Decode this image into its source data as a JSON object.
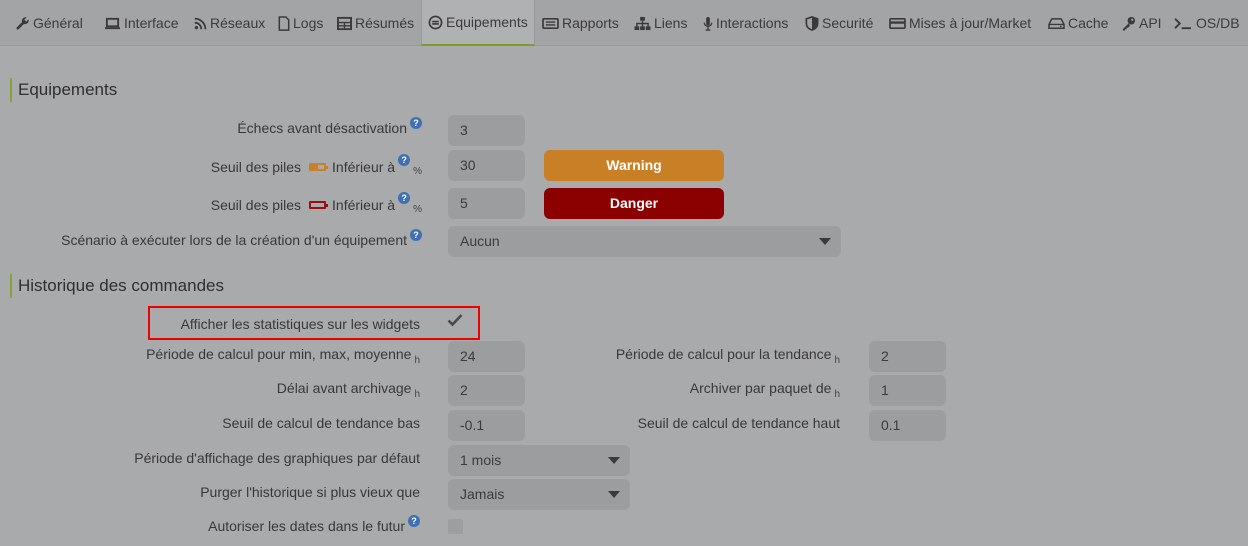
{
  "tabs": [
    {
      "label": "Général",
      "icon": "wrench-icon"
    },
    {
      "label": "Interface",
      "icon": "laptop-icon"
    },
    {
      "label": "Réseaux",
      "icon": "rss-icon"
    },
    {
      "label": "Logs",
      "icon": "file-icon"
    },
    {
      "label": "Résumés",
      "icon": "table-icon"
    },
    {
      "label": "Equipements",
      "icon": "equipment-icon"
    },
    {
      "label": "Rapports",
      "icon": "newspaper-icon"
    },
    {
      "label": "Liens",
      "icon": "sitemap-icon"
    },
    {
      "label": "Interactions",
      "icon": "microphone-icon"
    },
    {
      "label": "Securité",
      "icon": "shield-icon"
    },
    {
      "label": "Mises à jour/Market",
      "icon": "credit-card-icon"
    },
    {
      "label": "Cache",
      "icon": "hdd-icon"
    },
    {
      "label": "API",
      "icon": "key-icon"
    },
    {
      "label": "OS/DB",
      "icon": "terminal-icon"
    }
  ],
  "active_tab": "Equipements",
  "equipements": {
    "title": "Equipements",
    "echecs_label": "Échecs avant désactivation",
    "echecs_value": "3",
    "piles_label": "Seuil des piles",
    "inferieur_label": "Inférieur à",
    "percent_unit": "%",
    "warning_value": "30",
    "warning_label": "Warning",
    "danger_value": "5",
    "danger_label": "Danger",
    "scenario_label": "Scénario à exécuter lors de la création d'un équipement",
    "scenario_value": "Aucun",
    "colors": {
      "warning": "#c97f25",
      "danger": "#8b0000",
      "accent": "#86a03a"
    }
  },
  "historique": {
    "title": "Historique des commandes",
    "stats_label": "Afficher les statistiques sur les widgets",
    "stats_checked": true,
    "periode_minmax_label": "Période de calcul pour min, max, moyenne",
    "periode_minmax_value": "24",
    "periode_tendance_label": "Période de calcul pour la tendance",
    "periode_tendance_value": "2",
    "delai_label": "Délai avant archivage",
    "delai_value": "2",
    "paquet_label": "Archiver par paquet de",
    "paquet_value": "1",
    "seuil_bas_label": "Seuil de calcul de tendance bas",
    "seuil_bas_value": "-0.1",
    "seuil_haut_label": "Seuil de calcul de tendance haut",
    "seuil_haut_value": "0.1",
    "periode_graph_label": "Période d'affichage des graphiques par défaut",
    "periode_graph_value": "1 mois",
    "purger_label": "Purger l'historique si plus vieux que",
    "purger_value": "Jamais",
    "futur_label": "Autoriser les dates dans le futur",
    "futur_checked": false,
    "hour_unit": "h"
  }
}
